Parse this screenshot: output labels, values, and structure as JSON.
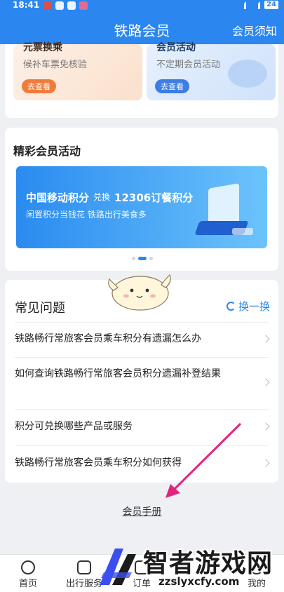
{
  "status_bar": {
    "time": "18:41",
    "battery": "24"
  },
  "header": {
    "title": "铁路会员",
    "notice": "会员须知"
  },
  "promos": [
    {
      "title": "元票换乘",
      "subtitle": "候补车票免核验",
      "button": "去查看"
    },
    {
      "title": "会员活动",
      "subtitle": "不定期会员活动",
      "button": "去查看"
    }
  ],
  "activities": {
    "title": "精彩会员活动",
    "banner": {
      "left": "中国移动积分",
      "middle": "兑换",
      "right": "12306订餐积分",
      "subtitle": "闲置积分当钱花 铁路出行美食多"
    },
    "page_count": 3,
    "active_page": 1
  },
  "faq": {
    "title": "常见问题",
    "refresh": "换一换",
    "items": [
      "铁路畅行常旅客会员乘车积分有遗漏怎么办",
      "如何查询铁路畅行常旅客会员积分遗漏补登结果",
      "积分可兑换哪些产品或服务",
      "铁路畅行常旅客会员乘车积分如何获得"
    ]
  },
  "manual": "会员手册",
  "tabs": [
    "首页",
    "出行服务",
    "订单",
    "我的"
  ],
  "watermark": {
    "text": "智者游戏网",
    "url": "zzslyxcfy.com"
  },
  "colors": {
    "brand": "#2c86f0",
    "accent_arrow": "#e0257e"
  }
}
